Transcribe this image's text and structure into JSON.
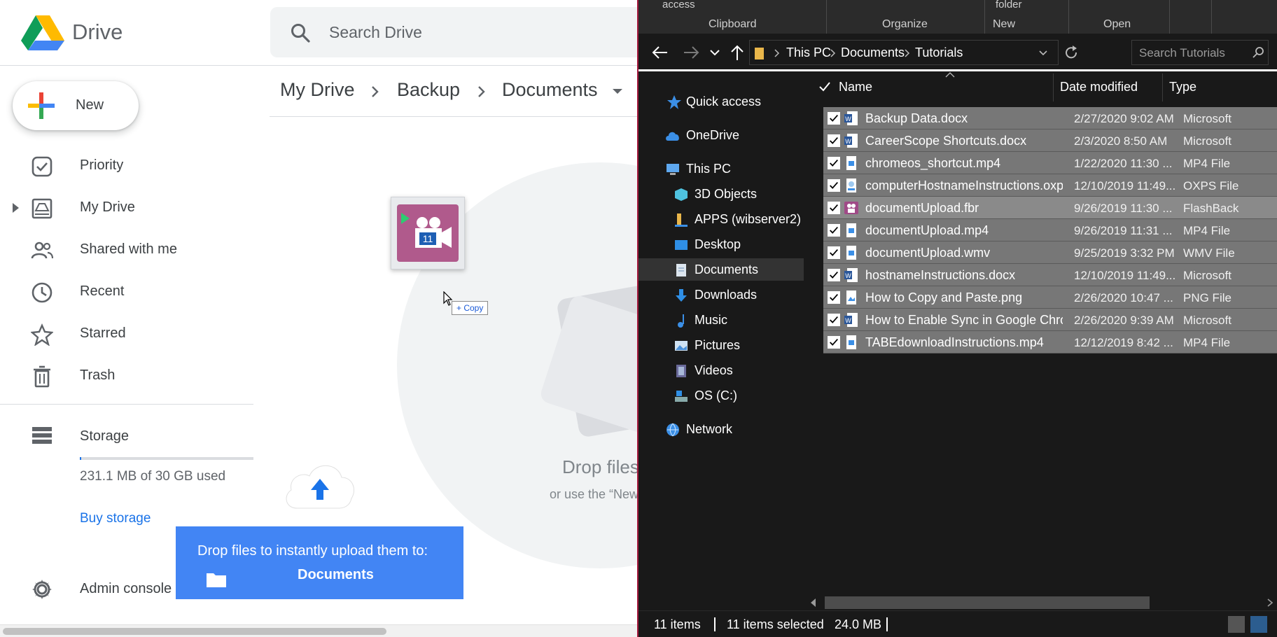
{
  "drive": {
    "app_name": "Drive",
    "search_placeholder": "Search Drive",
    "new_button": "New",
    "nav": [
      {
        "label": "Priority",
        "icon": "priority-icon"
      },
      {
        "label": "My Drive",
        "icon": "my-drive-icon"
      },
      {
        "label": "Shared with me",
        "icon": "shared-icon"
      },
      {
        "label": "Recent",
        "icon": "clock-icon"
      },
      {
        "label": "Starred",
        "icon": "star-icon"
      },
      {
        "label": "Trash",
        "icon": "trash-icon"
      }
    ],
    "storage": {
      "label": "Storage",
      "used_text": "231.1 MB of 30 GB used",
      "used_fraction": 0.0077,
      "buy_label": "Buy storage"
    },
    "admin_label": "Admin console",
    "breadcrumb": [
      "My Drive",
      "Backup",
      "Documents"
    ],
    "empty_title": "Drop files",
    "empty_sub": "or use the “New",
    "copy_tooltip": "+ Copy",
    "drop_toast": {
      "line1": "Drop files to instantly upload them to:",
      "folder": "Documents"
    },
    "colors": {
      "accent": "#1a73e8",
      "toast": "#4285f4"
    }
  },
  "explorer": {
    "ribbon": {
      "top_left": "access",
      "top_new": "folder",
      "groups": [
        "Clipboard",
        "Organize",
        "New",
        "Open"
      ]
    },
    "address": [
      "This PC",
      "Documents",
      "Tutorials"
    ],
    "search_placeholder": "Search Tutorials",
    "tree": [
      {
        "label": "Quick access",
        "icon": "star-icon",
        "level": 0
      },
      {
        "label": "OneDrive",
        "icon": "cloud-icon",
        "level": 0
      },
      {
        "label": "This PC",
        "icon": "computer-icon",
        "level": 0
      },
      {
        "label": "3D Objects",
        "icon": "cube-icon",
        "level": 1
      },
      {
        "label": "APPS (wibserver2)",
        "icon": "network-drive-icon",
        "level": 1
      },
      {
        "label": "Desktop",
        "icon": "desktop-icon",
        "level": 1
      },
      {
        "label": "Documents",
        "icon": "documents-icon",
        "level": 1
      },
      {
        "label": "Downloads",
        "icon": "download-icon",
        "level": 1
      },
      {
        "label": "Music",
        "icon": "music-icon",
        "level": 1
      },
      {
        "label": "Pictures",
        "icon": "pictures-icon",
        "level": 1
      },
      {
        "label": "Videos",
        "icon": "videos-icon",
        "level": 1
      },
      {
        "label": "OS (C:)",
        "icon": "drive-icon",
        "level": 1
      },
      {
        "label": "Network",
        "icon": "network-icon",
        "level": 0
      }
    ],
    "columns": [
      "Name",
      "Date modified",
      "Type"
    ],
    "files": [
      {
        "name": "Backup Data.docx",
        "date": "2/27/2020 9:02 AM",
        "type": "Microsoft",
        "icon": "word-doc-icon"
      },
      {
        "name": "CareerScope Shortcuts.docx",
        "date": "2/3/2020 8:50 AM",
        "type": "Microsoft",
        "icon": "word-doc-icon"
      },
      {
        "name": "chromeos_shortcut.mp4",
        "date": "1/22/2020 11:30 ...",
        "type": "MP4 File",
        "icon": "video-file-icon"
      },
      {
        "name": "computerHostnameInstructions.oxps",
        "date": "12/10/2019 11:49...",
        "type": "OXPS File",
        "icon": "oxps-file-icon"
      },
      {
        "name": "documentUpload.fbr",
        "date": "9/26/2019 11:30 ...",
        "type": "FlashBack",
        "icon": "flashback-icon"
      },
      {
        "name": "documentUpload.mp4",
        "date": "9/26/2019 11:31 ...",
        "type": "MP4 File",
        "icon": "video-file-icon"
      },
      {
        "name": "documentUpload.wmv",
        "date": "9/25/2019 3:32 PM",
        "type": "WMV File",
        "icon": "video-file-icon"
      },
      {
        "name": "hostnameInstructions.docx",
        "date": "12/10/2019 11:49...",
        "type": "Microsoft",
        "icon": "word-doc-icon"
      },
      {
        "name": "How to Copy and Paste.png",
        "date": "2/26/2020 10:47 ...",
        "type": "PNG File",
        "icon": "image-file-icon"
      },
      {
        "name": "How to Enable Sync in Google Chrom...",
        "date": "2/26/2020 9:39 AM",
        "type": "Microsoft",
        "icon": "word-doc-icon"
      },
      {
        "name": "TABEdownloadInstructions.mp4",
        "date": "12/12/2019 8:42 ...",
        "type": "MP4 File",
        "icon": "video-file-icon"
      }
    ],
    "status": {
      "count": "11 items",
      "selected": "11 items selected",
      "size": "24.0 MB"
    },
    "colors": {
      "border": "#a3193d",
      "selected_row": "#777777"
    }
  }
}
